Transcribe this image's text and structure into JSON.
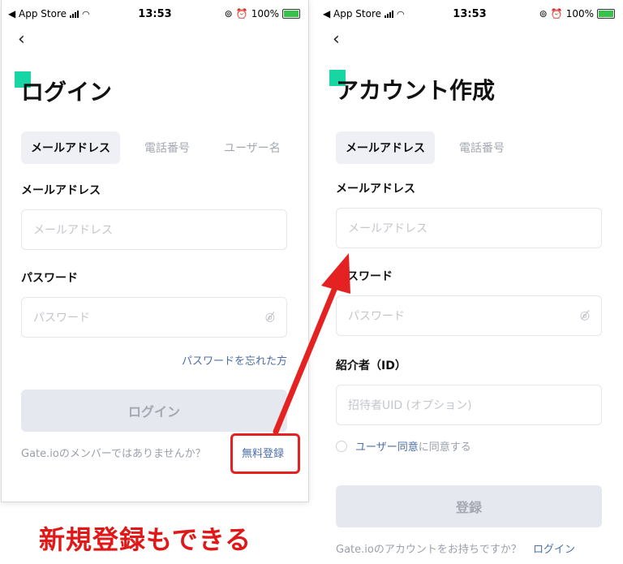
{
  "status_bar": {
    "back_app": "◀ App Store",
    "time": "13:53",
    "battery": "100%"
  },
  "login": {
    "title": "ログイン",
    "tabs": [
      "メールアドレス",
      "電話番号",
      "ユーザー名"
    ],
    "email_label": "メールアドレス",
    "email_placeholder": "メールアドレス",
    "password_label": "パスワード",
    "password_placeholder": "パスワード",
    "forgot_password": "パスワードを忘れた方",
    "login_button": "ログイン",
    "not_member": "Gate.ioのメンバーではありませんか？",
    "register_link": "無料登録"
  },
  "signup": {
    "title": "アカウント作成",
    "tabs": [
      "メールアドレス",
      "電話番号"
    ],
    "email_label": "メールアドレス",
    "email_placeholder": "メールアドレス",
    "password_label": "パスワード",
    "password_placeholder": "パスワード",
    "referrer_label": "紹介者（ID）",
    "referrer_placeholder": "招待者UID (オプション)",
    "agree_link": "ユーザー同意",
    "agree_suffix": "に同意する",
    "register_button": "登録",
    "have_account": "Gate.ioのアカウントをお持ちですか？",
    "login_link": "ログイン"
  },
  "caption": "新規登録もできる",
  "colors": {
    "accent": "#17d6a3",
    "link": "#4b6fa8",
    "annotation": "#e52222"
  }
}
